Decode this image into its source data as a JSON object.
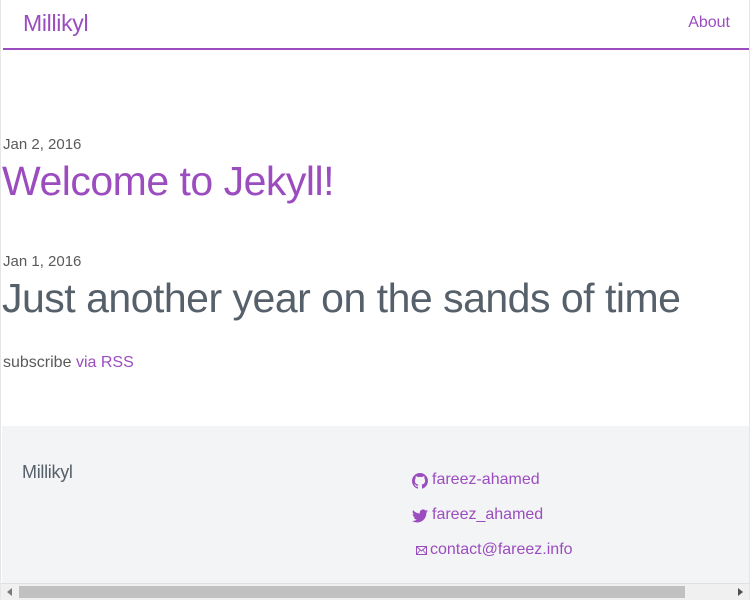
{
  "header": {
    "site_title": "Millikyl",
    "nav": [
      {
        "label": "About"
      }
    ]
  },
  "posts": [
    {
      "date": "Jan 2, 2016",
      "title": "Welcome to Jekyll!"
    },
    {
      "date": "Jan 1, 2016",
      "title": "Just another year on the sands of time"
    }
  ],
  "subscribe": {
    "prefix": "subscribe",
    "link_label": "via RSS"
  },
  "footer": {
    "title": "Millikyl",
    "contacts": [
      {
        "icon": "github-icon",
        "label": "fareez-ahamed"
      },
      {
        "icon": "twitter-icon",
        "label": "fareez_ahamed"
      },
      {
        "icon": "mail-icon",
        "label": "contact@fareez.info"
      }
    ]
  },
  "colors": {
    "accent": "#9b4dbf",
    "text": "#56606a",
    "footer_bg": "#f3f4f5"
  }
}
